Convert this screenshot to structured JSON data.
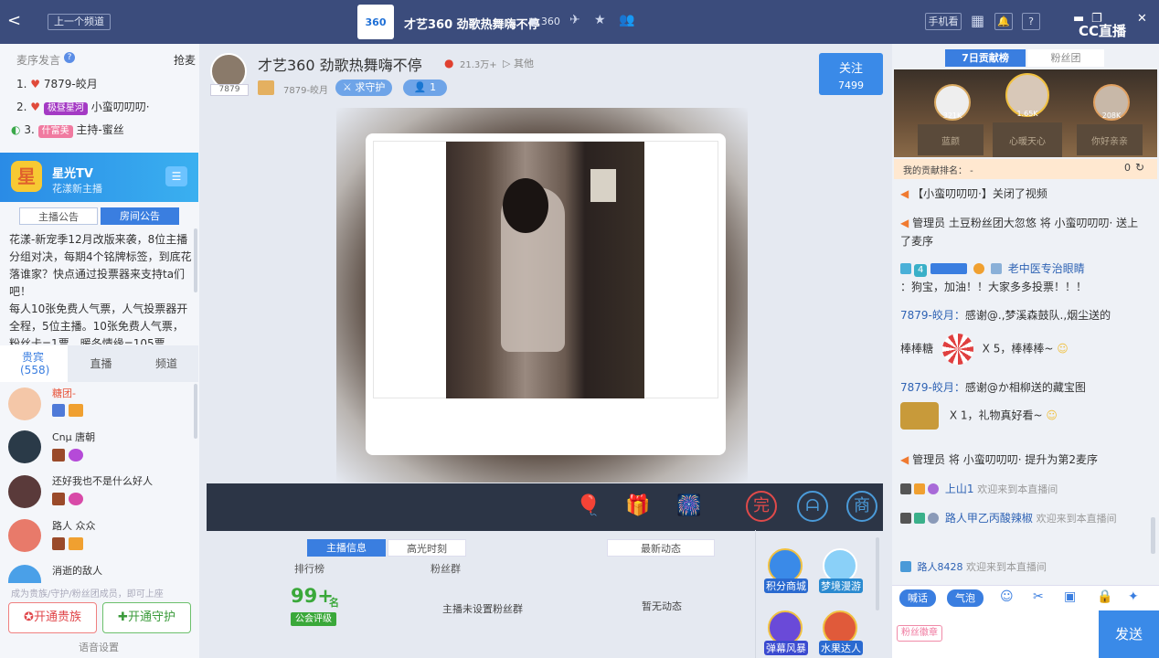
{
  "topbar": {
    "back_glyph": "<",
    "prev_channel": "上一个频道",
    "logo_text": "360",
    "title": "才艺360 劲歌热舞嗨不停",
    "room_id": "360",
    "phone_btn": "手机看",
    "cc_logo": "CC直播",
    "minimize": "▬",
    "restore": "❐",
    "close": "✕"
  },
  "left": {
    "mic_label": "麦序发言",
    "grab": "抢麦",
    "mic_list": [
      {
        "num": "1.",
        "name": "7879-皎月"
      },
      {
        "num": "2.",
        "badge": "极昼星河",
        "name": "小蛮叨叨叨·"
      },
      {
        "num": "3.",
        "badge": "什富美",
        "name": "主持-蜜丝"
      }
    ],
    "banner_title": "星光TV",
    "banner_sub": "花漾新主播",
    "banner_icon": "星",
    "notice_tabs": [
      "主播公告",
      "房间公告"
    ],
    "notice": "花漾-新宠季12月改版来袭，8位主播分组对决，每期4个铭牌标签，到底花落谁家？快点通过投票器来支持ta们吧！\n每人10张免费人气票，人气投票器开全程，5位主播。10张免费人气票，粉丝卡=1票、暖冬情缘=105票",
    "user_tabs": [
      {
        "label": "贵宾",
        "count": "(558)"
      },
      {
        "label": "直播"
      },
      {
        "label": "频道"
      }
    ],
    "users": [
      {
        "name": "糖团-",
        "color": "#e8543a"
      },
      {
        "name": "Cnμ 唐朝",
        "color": "#333"
      },
      {
        "name": "还好我也不是什么好人",
        "color": "#333"
      },
      {
        "name": "路人 众众",
        "color": "#333"
      },
      {
        "name": "消逝的敌人",
        "color": "#333"
      }
    ],
    "hint": "成为贵族/守护/粉丝团成员，即可上座",
    "btn_noble": "开通贵族",
    "btn_guard": "开通守护",
    "voice": "语音设置"
  },
  "center": {
    "room_title": "才艺360 劲歌热舞嗨不停",
    "heat": "21.3万+",
    "other": "其他",
    "anchor_id": "7879",
    "anchor_name": "7879-皎月",
    "guard_btn": "求守护",
    "guard_count": "1",
    "follow": "关注",
    "follow_count": "7499",
    "info_tabs": [
      "主播信息",
      "高光时刻"
    ],
    "news_tab": "最新动态",
    "rank_label": "排行榜",
    "fans_label": "粉丝群",
    "rank_value": "99+",
    "rank_unit": "名",
    "guild": "公会评级",
    "fans_empty": "主播未设置粉丝群",
    "news_empty": "暂无动态",
    "side_btns": [
      "积分商城",
      "梦境漫游",
      "弹幕风暴",
      "水果达人"
    ]
  },
  "right": {
    "tabs": [
      "7日贡献榜",
      "粉丝团"
    ],
    "podium": [
      {
        "name": "蓝颜",
        "score": "321K"
      },
      {
        "name": "心暖天心",
        "score": "1.65K"
      },
      {
        "name": "你好亲亲",
        "score": "208K"
      }
    ],
    "my_rank": "我的贡献排名：  -",
    "my_score": "0",
    "chat": [
      "【小蛮叨叨叨·】关闭了视频",
      "管理员  土豆粉丝团大忽悠  将  小蛮叨叨叨·  送上了麦序",
      "老中医专治眼睛",
      "：狗宝，加油！！大家多多投票！！！",
      "7879-皎月：",
      "感谢@.,梦溪森鼓队.,烟尘送的",
      "棒棒糖",
      "X 5，棒棒棒~",
      "7879-皎月：",
      "感谢@か相柳送的藏宝图",
      "X 1，礼物真好看~",
      "管理员   将  小蛮叨叨叨·  提升为第2麦序",
      "上山1",
      "欢迎来到本直播间",
      "路人甲乙丙酸辣椒",
      "欢迎来到本直播间",
      "路人8428",
      "欢迎来到本直播间"
    ],
    "badge_lv": "4",
    "chip1": "喊话",
    "chip2": "气泡",
    "fan_badge": "粉丝徽章",
    "send": "发送"
  }
}
